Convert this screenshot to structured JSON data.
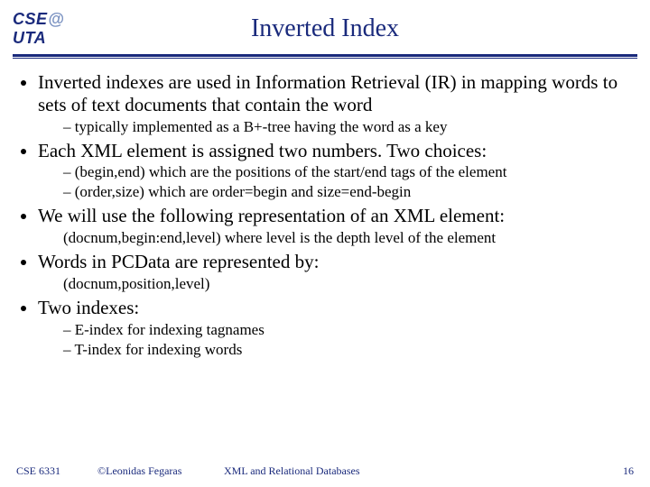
{
  "logo": {
    "left": "CSE",
    "at": "@",
    "right": "UTA"
  },
  "title": "Inverted Index",
  "bullets": [
    {
      "text": "Inverted indexes are used in Information Retrieval (IR) in mapping words to sets of text documents that contain the word",
      "sub_dash": [
        "typically implemented as a B+-tree having the word as a key"
      ]
    },
    {
      "text": "Each XML element is assigned two numbers. Two choices:",
      "sub_dash": [
        "(begin,end) which are the positions of the start/end tags of the element",
        "(order,size) which are order=begin and size=end-begin"
      ]
    },
    {
      "text": "We will use the following representation of an XML element:",
      "sub_plain": "(docnum,begin:end,level) where level is the depth level of the element"
    },
    {
      "text": "Words in PCData are represented by:",
      "sub_plain": "(docnum,position,level)"
    },
    {
      "text": "Two indexes:",
      "sub_dash": [
        "E-index for indexing tagnames",
        "T-index for indexing words"
      ]
    }
  ],
  "footer": {
    "course": "CSE 6331",
    "copyright": "©Leonidas Fegaras",
    "topic": "XML and Relational Databases",
    "page": "16"
  }
}
